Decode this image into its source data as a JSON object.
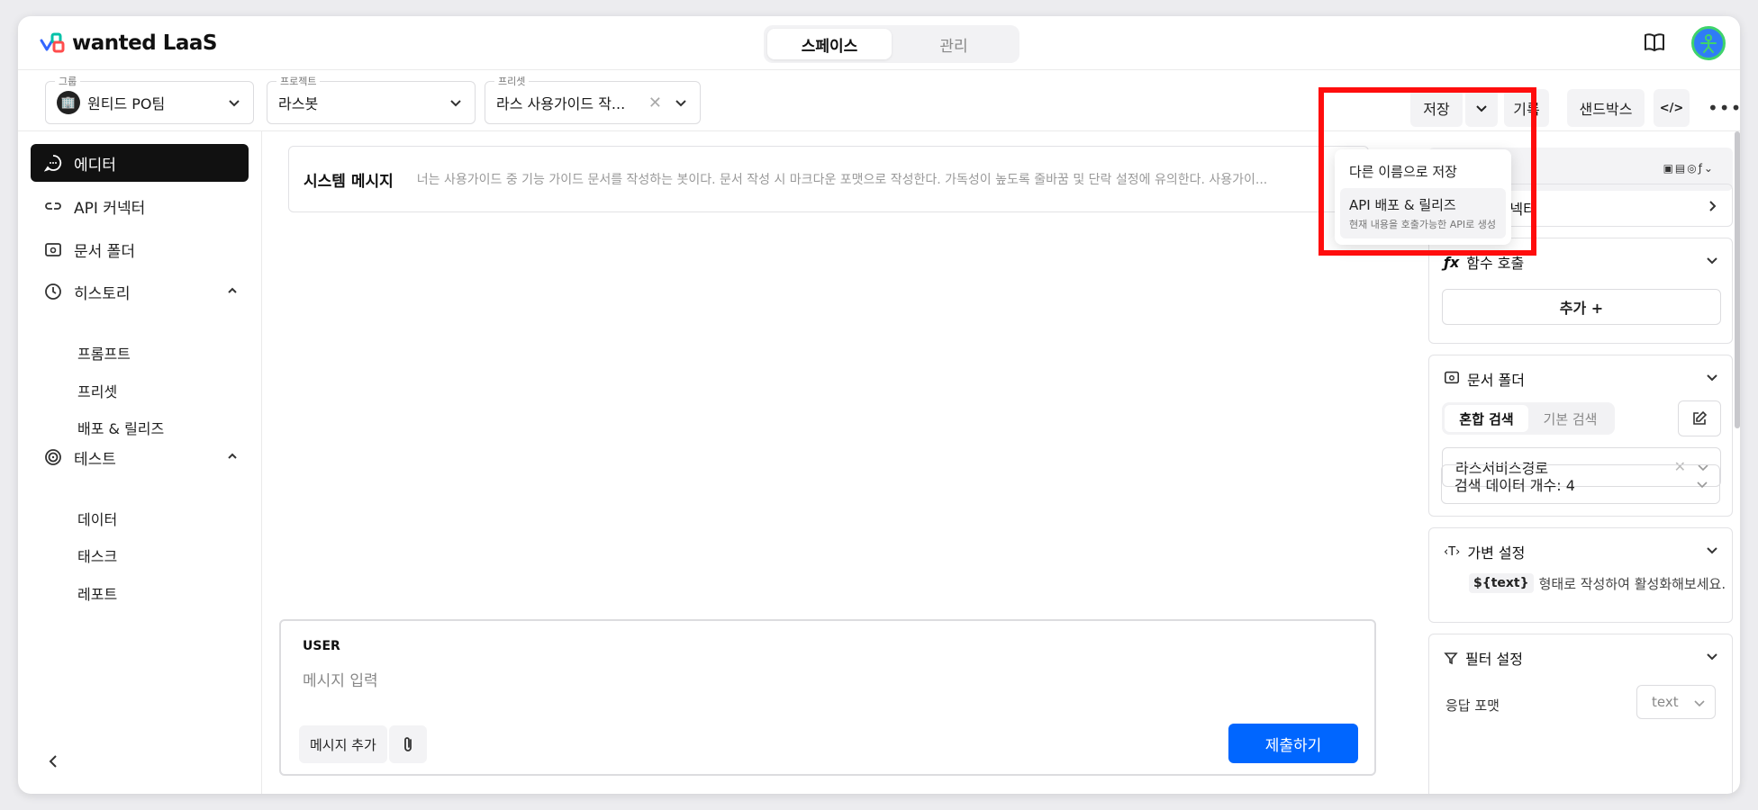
{
  "app": {
    "logo_text": "wanted LaaS"
  },
  "nav_tabs": [
    {
      "label": "스페이스",
      "active": true
    },
    {
      "label": "관리",
      "active": false
    }
  ],
  "toolbar": {
    "group": {
      "legend": "그룹",
      "value": "원티드 PO팀"
    },
    "project": {
      "legend": "프로젝트",
      "value": "라스봇"
    },
    "preset": {
      "legend": "프리셋",
      "value": "라스 사용가이드 작..."
    },
    "save_label": "저장",
    "history_label": "기록",
    "sandbox_label": "샌드박스"
  },
  "save_menu": {
    "items": [
      {
        "label": "다른 이름으로 저장",
        "sub": ""
      },
      {
        "label": "API 배포 & 릴리즈",
        "sub": "현재 내용을 호출가능한 API로 생성"
      }
    ]
  },
  "sidebar": {
    "items": [
      {
        "label": "에디터",
        "icon": "chat-icon",
        "active": true
      },
      {
        "label": "API 커넥터",
        "icon": "link-icon",
        "active": false
      },
      {
        "label": "문서 폴더",
        "icon": "folder-search-icon",
        "active": false
      },
      {
        "label": "히스토리",
        "icon": "clock-icon",
        "active": false
      },
      {
        "label": "테스트",
        "icon": "target-icon",
        "active": false
      }
    ],
    "history_sub": [
      "프롬프트",
      "프리셋",
      "배포 & 릴리즈"
    ],
    "test_sub": [
      "데이터",
      "태스크",
      "레포트"
    ]
  },
  "editor": {
    "system_label": "시스템 메시지",
    "system_text": "너는 사용가이드 중 기능 가이드 문서를 작성하는 봇이다. 문서 작성 시 마크다운 포맷으로 작성한다. 가독성이 높도록 줄바꿈 및 단락 설정에 유의한다. 사용가이...",
    "role": "USER",
    "placeholder": "메시지 입력",
    "add_message": "메시지 추가",
    "submit": "제출하기"
  },
  "right_panel": {
    "api_connector": "API 커넥터",
    "function_call": "함수 호출",
    "add_label": "추가 +",
    "doc_folder": "문서 폴더",
    "search_tabs": [
      {
        "label": "혼합 검색",
        "active": true
      },
      {
        "label": "기본 검색",
        "active": false
      }
    ],
    "doc_value": "라스서비스경로",
    "search_count": "검색 데이터 개수: 4",
    "variable": "가변 설정",
    "variable_code": "${text}",
    "variable_hint": "형태로 작성하여 활성화해보세요.",
    "filter": "필터 설정",
    "response_format_label": "응답 포맷",
    "response_format_value": "text"
  },
  "colors": {
    "primary": "#0066ff",
    "highlight": "#ff0d0d",
    "active_nav": "#111111"
  }
}
